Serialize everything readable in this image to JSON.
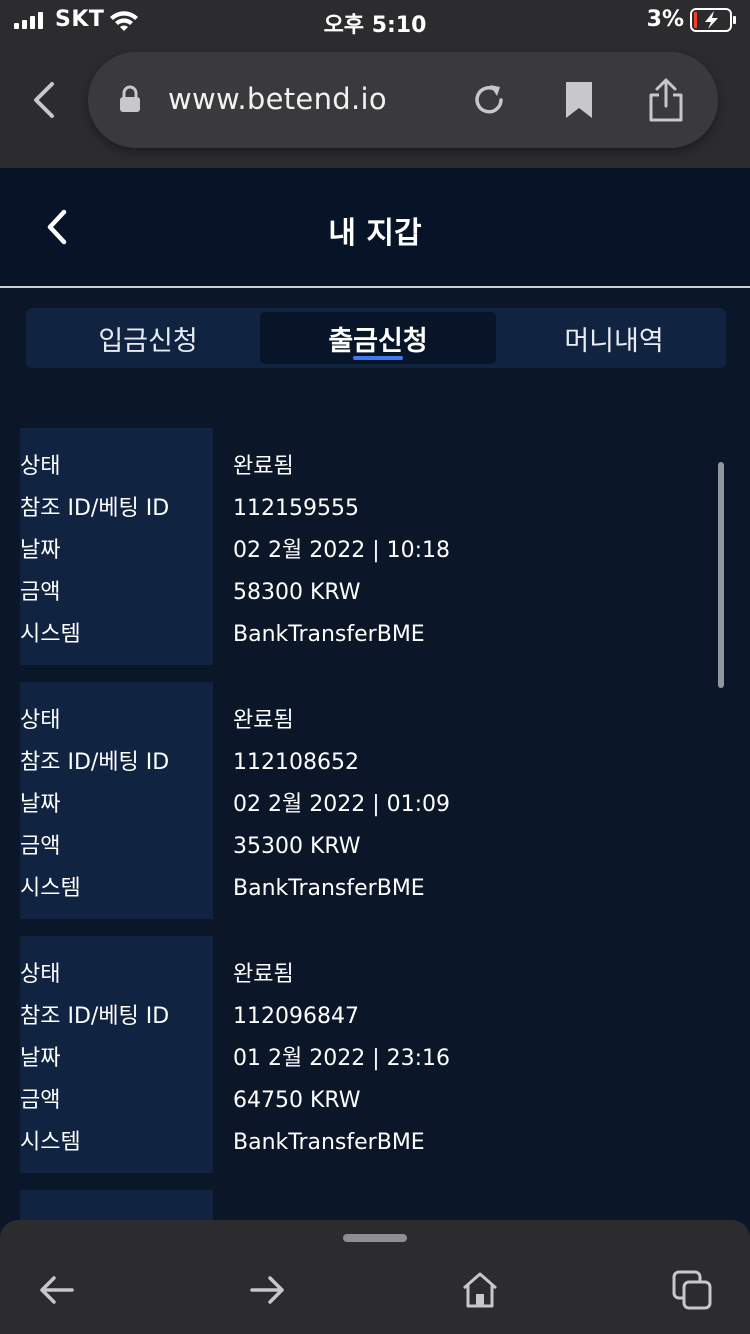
{
  "status_bar": {
    "carrier": "SKT",
    "time": "오후 5:10",
    "battery_percent": "3%",
    "signal_bars": 4
  },
  "browser": {
    "url": "www.betend.io",
    "icons": [
      "chevron-left-icon",
      "lock-icon",
      "reload-icon",
      "bookmark-icon",
      "share-icon"
    ]
  },
  "header": {
    "title": "내 지갑"
  },
  "tabs": [
    {
      "label": "입금신청",
      "active": false
    },
    {
      "label": "출금신청",
      "active": true
    },
    {
      "label": "머니내역",
      "active": false
    }
  ],
  "record_fields": [
    "상태",
    "참조 ID/베팅 ID",
    "날짜",
    "금액",
    "시스템"
  ],
  "records": [
    {
      "status": "완료됨",
      "ref_id": "112159555",
      "date": "02 2월 2022 | 10:18",
      "amount": "58300 KRW",
      "system": "BankTransferBME"
    },
    {
      "status": "완료됨",
      "ref_id": "112108652",
      "date": "02 2월 2022 | 01:09",
      "amount": "35300 KRW",
      "system": "BankTransferBME"
    },
    {
      "status": "완료됨",
      "ref_id": "112096847",
      "date": "01 2월 2022 | 23:16",
      "amount": "64750 KRW",
      "system": "BankTransferBME"
    }
  ],
  "colors": {
    "page_bg": "#0b1628",
    "header_bg": "#071428",
    "panel_bg": "#102341",
    "accent": "#3f7bf0",
    "browser_chrome": "#2c2c2e",
    "battery_low": "#ff3b30"
  },
  "toolbar": {
    "icons": [
      "arrow-left-icon",
      "arrow-right-icon",
      "home-icon",
      "tabs-icon"
    ]
  }
}
